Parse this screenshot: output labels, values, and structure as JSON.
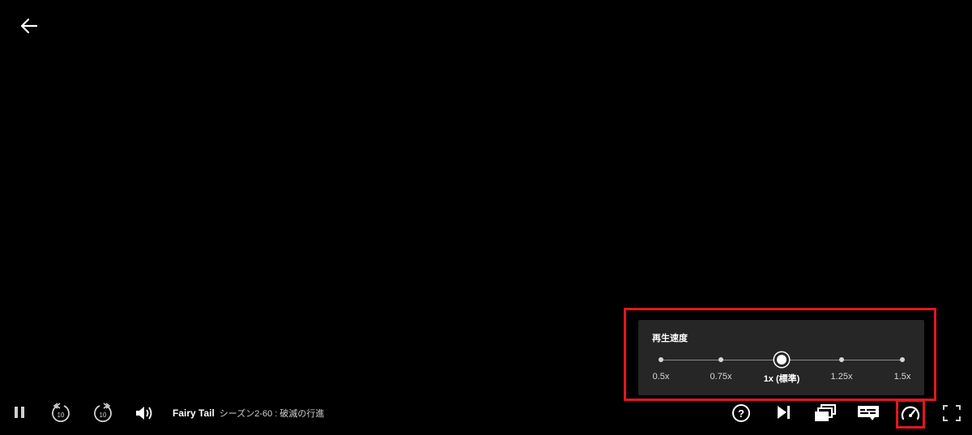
{
  "player": {
    "title": "Fairy Tail",
    "episode": "シーズン2-60 : 破滅の行進"
  },
  "speed_menu": {
    "heading": "再生速度",
    "options": [
      {
        "label": "0.5x",
        "selected": false
      },
      {
        "label": "0.75x",
        "selected": false
      },
      {
        "label": "1x (標準)",
        "selected": true
      },
      {
        "label": "1.25x",
        "selected": false
      },
      {
        "label": "1.5x",
        "selected": false
      }
    ]
  },
  "icons": {
    "back": "arrow-left-icon",
    "pause": "pause-icon",
    "rewind": "rewind-10-icon",
    "forward": "forward-10-icon",
    "volume": "volume-icon",
    "help": "help-icon",
    "next": "next-episode-icon",
    "episodes": "episodes-icon",
    "subtitles": "subtitles-icon",
    "speed": "speedometer-icon",
    "fullscreen": "fullscreen-icon"
  },
  "colors": {
    "background": "#000000",
    "panel": "#262626",
    "highlight": "#e3161e",
    "text": "#ffffff"
  }
}
